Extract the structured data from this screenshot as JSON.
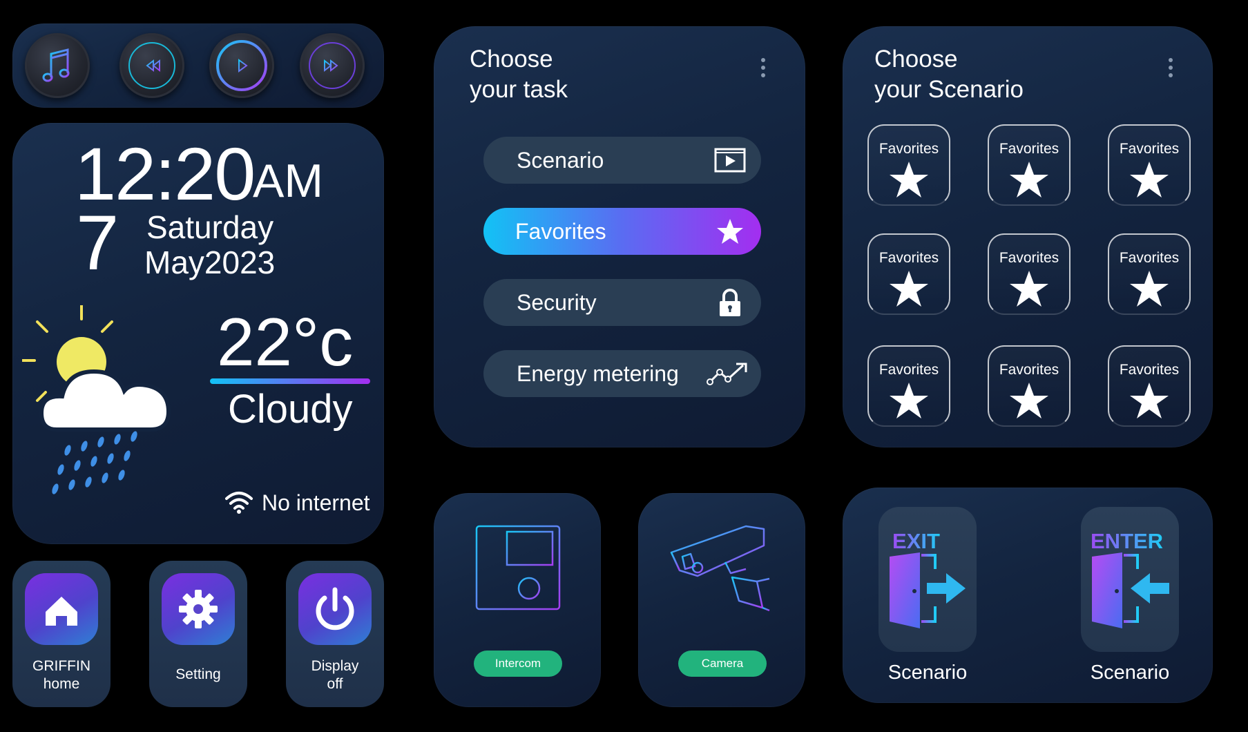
{
  "media": {
    "buttons": [
      {
        "name": "music-icon"
      },
      {
        "name": "rewind-icon"
      },
      {
        "name": "play-icon"
      },
      {
        "name": "fast-forward-icon"
      }
    ]
  },
  "clock": {
    "time": "12:20",
    "ampm": "AM",
    "day_number": "7",
    "weekday": "Saturday",
    "month_year": "May2023",
    "temperature": "22°c",
    "condition": "Cloudy",
    "network_status": "No internet",
    "weather_icon": "partly-cloudy-rain-icon",
    "wifi_icon": "wifi-icon"
  },
  "tiles": [
    {
      "label_line1": "GRIFFIN",
      "label_line2": "home",
      "icon": "home-icon"
    },
    {
      "label_line1": "Setting",
      "label_line2": "",
      "icon": "gear-icon"
    },
    {
      "label_line1": "Display",
      "label_line2": "off",
      "icon": "power-icon"
    }
  ],
  "task_panel": {
    "title": "Choose\nyour task",
    "items": [
      {
        "label": "Scenario",
        "icon": "play-box-icon",
        "active": false
      },
      {
        "label": "Favorites",
        "icon": "star-icon",
        "active": true
      },
      {
        "label": "Security",
        "icon": "lock-icon",
        "active": false
      },
      {
        "label": "Energy metering",
        "icon": "trend-chart-icon",
        "active": false
      }
    ]
  },
  "scenario_panel": {
    "title": "Choose\nyour Scenario",
    "favorites": [
      "Favorites",
      "Favorites",
      "Favorites",
      "Favorites",
      "Favorites",
      "Favorites",
      "Favorites",
      "Favorites",
      "Favorites"
    ]
  },
  "devices": [
    {
      "label": "Intercom",
      "icon": "intercom-icon"
    },
    {
      "label": "Camera",
      "icon": "security-camera-icon"
    }
  ],
  "exit_enter": [
    {
      "sign": "EXIT",
      "label": "Scenario",
      "icon": "exit-door-icon"
    },
    {
      "sign": "ENTER",
      "label": "Scenario",
      "icon": "enter-door-icon"
    }
  ],
  "colors": {
    "accent_start": "#12c2f5",
    "accent_end": "#a32ef0",
    "green_button": "#22b37d",
    "panel_bg": "#13243f"
  }
}
